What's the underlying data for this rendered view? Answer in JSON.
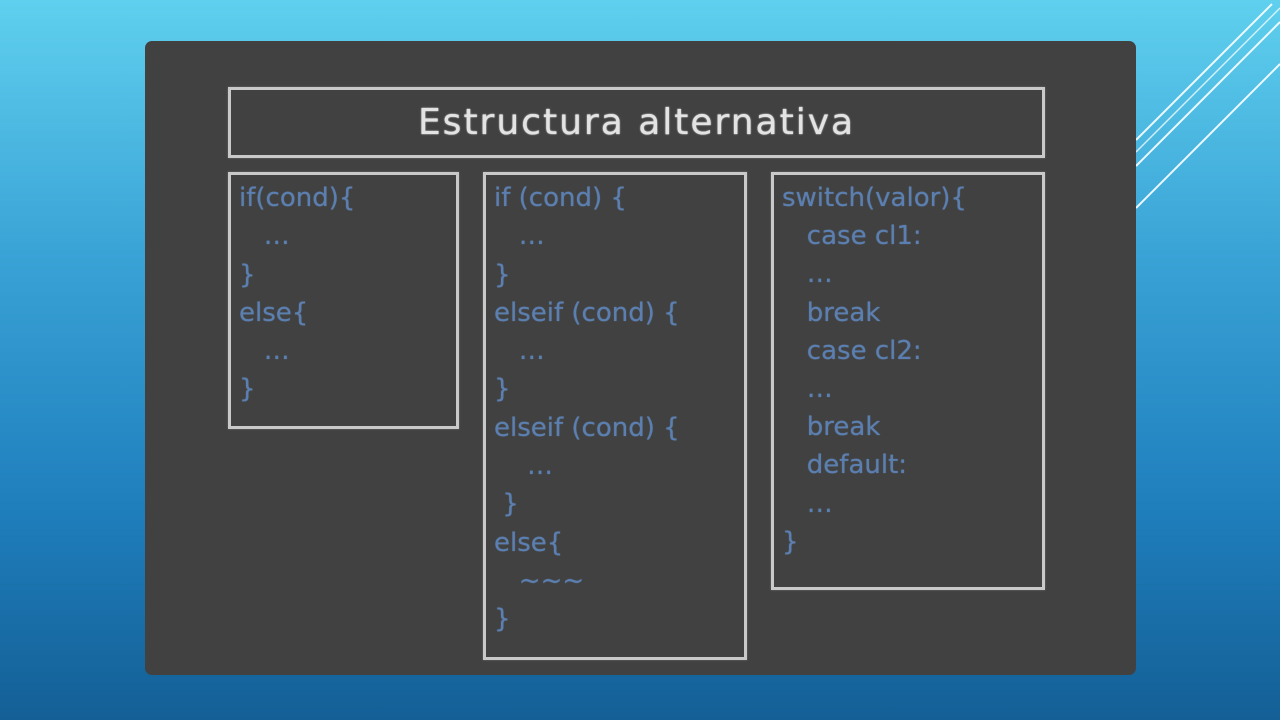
{
  "title": "Estructura alternativa",
  "colors": {
    "board": "#414141",
    "frame": "#c9c9c9",
    "title_text": "#e3e3e3",
    "code_text": "#5a7fb0",
    "background_top": "#5fd0ee",
    "background_bottom": "#145f96"
  },
  "code_blocks": [
    {
      "lines": [
        "if(cond){",
        "   …",
        "}",
        "else{",
        "   …",
        "}"
      ]
    },
    {
      "lines": [
        "if (cond) {",
        "   …",
        "}",
        "elseif (cond) {",
        "   …",
        "}",
        "elseif (cond) {",
        "    …",
        " }",
        "else{",
        "   ~~~",
        "}"
      ]
    },
    {
      "lines": [
        "switch(valor){",
        "   case cl1:",
        "   …",
        "   break",
        "   case cl2:",
        "   …",
        "   break",
        "   default:",
        "   …",
        "}"
      ]
    }
  ]
}
